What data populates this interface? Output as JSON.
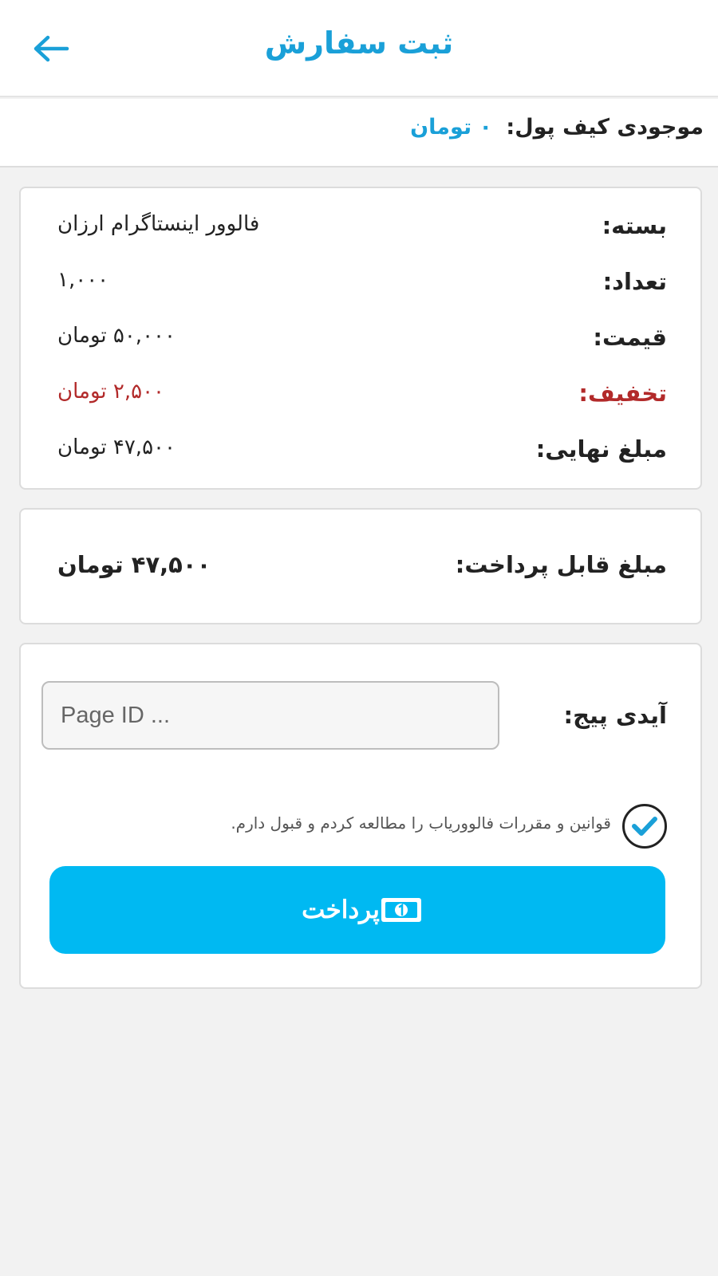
{
  "header": {
    "title": "ثبت سفارش",
    "back_icon": "arrow-left-icon"
  },
  "wallet": {
    "label": "موجودی کیف پول:",
    "amount": "۰ تومان",
    "color": "#1aa0d8"
  },
  "details": {
    "package_label": "بسته:",
    "package_value": "فالوور اینستاگرام ارزان",
    "quantity_label": "تعداد:",
    "quantity_value": "۱,۰۰۰",
    "price_label": "قیمت:",
    "price_value": "۵۰,۰۰۰ تومان",
    "discount_label": "تخفیف:",
    "discount_value": "۲,۵۰۰ تومان",
    "final_label": "مبلغ نهایی:",
    "final_value": "۴۷,۵۰۰ تومان",
    "discount_color": "#b22a2a"
  },
  "payable": {
    "label": "مبلغ قابل پرداخت:",
    "amount": "۴۷,۵۰۰ تومان"
  },
  "form": {
    "page_id_label": "آیدی پیج:",
    "page_id_placeholder": "Page ID ...",
    "page_id_value": "",
    "terms_text": "قوانین و مقررات فالووریاب را مطالعه کردم و قبول دارم.",
    "terms_checked": true,
    "check_icon": "checkmark-icon",
    "pay_label": "پرداخت",
    "pay_icon": "money-bill-icon",
    "pay_color": "#00b9f2"
  }
}
